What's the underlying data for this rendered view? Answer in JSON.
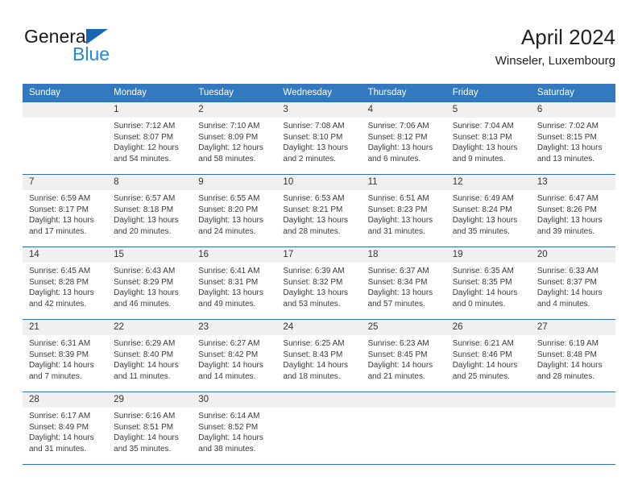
{
  "brand": {
    "name_top": "General",
    "name_bottom": "Blue",
    "accent_color": "#2289d6",
    "triangle_color": "#1667b0"
  },
  "header": {
    "title": "April 2024",
    "subtitle": "Winseler, Luxembourg"
  },
  "theme": {
    "header_bar_color": "#3279bd",
    "daynum_band_color": "#f0f0f0",
    "row_border_color": "#2f6fae",
    "text_color": "#3a3a3a"
  },
  "weekdays": [
    "Sunday",
    "Monday",
    "Tuesday",
    "Wednesday",
    "Thursday",
    "Friday",
    "Saturday"
  ],
  "weeks": [
    [
      {
        "day": "",
        "sunrise": "",
        "sunset": "",
        "daylight_line1": "",
        "daylight_line2": ""
      },
      {
        "day": "1",
        "sunrise": "Sunrise: 7:12 AM",
        "sunset": "Sunset: 8:07 PM",
        "daylight_line1": "Daylight: 12 hours",
        "daylight_line2": "and 54 minutes."
      },
      {
        "day": "2",
        "sunrise": "Sunrise: 7:10 AM",
        "sunset": "Sunset: 8:09 PM",
        "daylight_line1": "Daylight: 12 hours",
        "daylight_line2": "and 58 minutes."
      },
      {
        "day": "3",
        "sunrise": "Sunrise: 7:08 AM",
        "sunset": "Sunset: 8:10 PM",
        "daylight_line1": "Daylight: 13 hours",
        "daylight_line2": "and 2 minutes."
      },
      {
        "day": "4",
        "sunrise": "Sunrise: 7:06 AM",
        "sunset": "Sunset: 8:12 PM",
        "daylight_line1": "Daylight: 13 hours",
        "daylight_line2": "and 6 minutes."
      },
      {
        "day": "5",
        "sunrise": "Sunrise: 7:04 AM",
        "sunset": "Sunset: 8:13 PM",
        "daylight_line1": "Daylight: 13 hours",
        "daylight_line2": "and 9 minutes."
      },
      {
        "day": "6",
        "sunrise": "Sunrise: 7:02 AM",
        "sunset": "Sunset: 8:15 PM",
        "daylight_line1": "Daylight: 13 hours",
        "daylight_line2": "and 13 minutes."
      }
    ],
    [
      {
        "day": "7",
        "sunrise": "Sunrise: 6:59 AM",
        "sunset": "Sunset: 8:17 PM",
        "daylight_line1": "Daylight: 13 hours",
        "daylight_line2": "and 17 minutes."
      },
      {
        "day": "8",
        "sunrise": "Sunrise: 6:57 AM",
        "sunset": "Sunset: 8:18 PM",
        "daylight_line1": "Daylight: 13 hours",
        "daylight_line2": "and 20 minutes."
      },
      {
        "day": "9",
        "sunrise": "Sunrise: 6:55 AM",
        "sunset": "Sunset: 8:20 PM",
        "daylight_line1": "Daylight: 13 hours",
        "daylight_line2": "and 24 minutes."
      },
      {
        "day": "10",
        "sunrise": "Sunrise: 6:53 AM",
        "sunset": "Sunset: 8:21 PM",
        "daylight_line1": "Daylight: 13 hours",
        "daylight_line2": "and 28 minutes."
      },
      {
        "day": "11",
        "sunrise": "Sunrise: 6:51 AM",
        "sunset": "Sunset: 8:23 PM",
        "daylight_line1": "Daylight: 13 hours",
        "daylight_line2": "and 31 minutes."
      },
      {
        "day": "12",
        "sunrise": "Sunrise: 6:49 AM",
        "sunset": "Sunset: 8:24 PM",
        "daylight_line1": "Daylight: 13 hours",
        "daylight_line2": "and 35 minutes."
      },
      {
        "day": "13",
        "sunrise": "Sunrise: 6:47 AM",
        "sunset": "Sunset: 8:26 PM",
        "daylight_line1": "Daylight: 13 hours",
        "daylight_line2": "and 39 minutes."
      }
    ],
    [
      {
        "day": "14",
        "sunrise": "Sunrise: 6:45 AM",
        "sunset": "Sunset: 8:28 PM",
        "daylight_line1": "Daylight: 13 hours",
        "daylight_line2": "and 42 minutes."
      },
      {
        "day": "15",
        "sunrise": "Sunrise: 6:43 AM",
        "sunset": "Sunset: 8:29 PM",
        "daylight_line1": "Daylight: 13 hours",
        "daylight_line2": "and 46 minutes."
      },
      {
        "day": "16",
        "sunrise": "Sunrise: 6:41 AM",
        "sunset": "Sunset: 8:31 PM",
        "daylight_line1": "Daylight: 13 hours",
        "daylight_line2": "and 49 minutes."
      },
      {
        "day": "17",
        "sunrise": "Sunrise: 6:39 AM",
        "sunset": "Sunset: 8:32 PM",
        "daylight_line1": "Daylight: 13 hours",
        "daylight_line2": "and 53 minutes."
      },
      {
        "day": "18",
        "sunrise": "Sunrise: 6:37 AM",
        "sunset": "Sunset: 8:34 PM",
        "daylight_line1": "Daylight: 13 hours",
        "daylight_line2": "and 57 minutes."
      },
      {
        "day": "19",
        "sunrise": "Sunrise: 6:35 AM",
        "sunset": "Sunset: 8:35 PM",
        "daylight_line1": "Daylight: 14 hours",
        "daylight_line2": "and 0 minutes."
      },
      {
        "day": "20",
        "sunrise": "Sunrise: 6:33 AM",
        "sunset": "Sunset: 8:37 PM",
        "daylight_line1": "Daylight: 14 hours",
        "daylight_line2": "and 4 minutes."
      }
    ],
    [
      {
        "day": "21",
        "sunrise": "Sunrise: 6:31 AM",
        "sunset": "Sunset: 8:39 PM",
        "daylight_line1": "Daylight: 14 hours",
        "daylight_line2": "and 7 minutes."
      },
      {
        "day": "22",
        "sunrise": "Sunrise: 6:29 AM",
        "sunset": "Sunset: 8:40 PM",
        "daylight_line1": "Daylight: 14 hours",
        "daylight_line2": "and 11 minutes."
      },
      {
        "day": "23",
        "sunrise": "Sunrise: 6:27 AM",
        "sunset": "Sunset: 8:42 PM",
        "daylight_line1": "Daylight: 14 hours",
        "daylight_line2": "and 14 minutes."
      },
      {
        "day": "24",
        "sunrise": "Sunrise: 6:25 AM",
        "sunset": "Sunset: 8:43 PM",
        "daylight_line1": "Daylight: 14 hours",
        "daylight_line2": "and 18 minutes."
      },
      {
        "day": "25",
        "sunrise": "Sunrise: 6:23 AM",
        "sunset": "Sunset: 8:45 PM",
        "daylight_line1": "Daylight: 14 hours",
        "daylight_line2": "and 21 minutes."
      },
      {
        "day": "26",
        "sunrise": "Sunrise: 6:21 AM",
        "sunset": "Sunset: 8:46 PM",
        "daylight_line1": "Daylight: 14 hours",
        "daylight_line2": "and 25 minutes."
      },
      {
        "day": "27",
        "sunrise": "Sunrise: 6:19 AM",
        "sunset": "Sunset: 8:48 PM",
        "daylight_line1": "Daylight: 14 hours",
        "daylight_line2": "and 28 minutes."
      }
    ],
    [
      {
        "day": "28",
        "sunrise": "Sunrise: 6:17 AM",
        "sunset": "Sunset: 8:49 PM",
        "daylight_line1": "Daylight: 14 hours",
        "daylight_line2": "and 31 minutes."
      },
      {
        "day": "29",
        "sunrise": "Sunrise: 6:16 AM",
        "sunset": "Sunset: 8:51 PM",
        "daylight_line1": "Daylight: 14 hours",
        "daylight_line2": "and 35 minutes."
      },
      {
        "day": "30",
        "sunrise": "Sunrise: 6:14 AM",
        "sunset": "Sunset: 8:52 PM",
        "daylight_line1": "Daylight: 14 hours",
        "daylight_line2": "and 38 minutes."
      },
      {
        "day": "",
        "sunrise": "",
        "sunset": "",
        "daylight_line1": "",
        "daylight_line2": ""
      },
      {
        "day": "",
        "sunrise": "",
        "sunset": "",
        "daylight_line1": "",
        "daylight_line2": ""
      },
      {
        "day": "",
        "sunrise": "",
        "sunset": "",
        "daylight_line1": "",
        "daylight_line2": ""
      },
      {
        "day": "",
        "sunrise": "",
        "sunset": "",
        "daylight_line1": "",
        "daylight_line2": ""
      }
    ]
  ]
}
